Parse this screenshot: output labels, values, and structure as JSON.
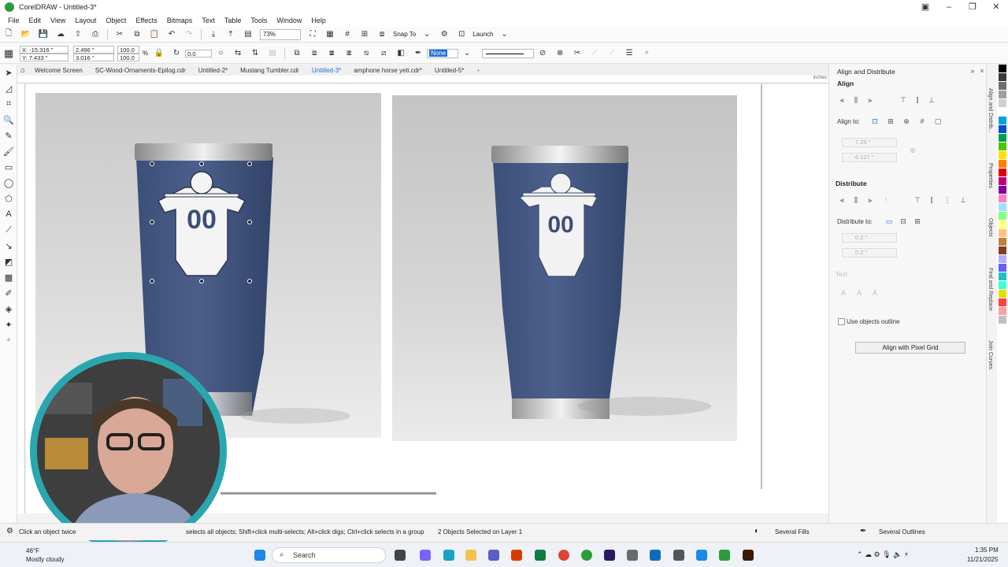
{
  "app": {
    "title": "CorelDRAW - Untitled-3*"
  },
  "menu": [
    "File",
    "Edit",
    "View",
    "Layout",
    "Object",
    "Effects",
    "Bitmaps",
    "Text",
    "Table",
    "Tools",
    "Window",
    "Help"
  ],
  "toolbar": {
    "zoom": "73%",
    "snap_to": "Snap To",
    "launch": "Launch"
  },
  "propbar": {
    "x": "X: -15.316 \"",
    "y": "Y: 7.433 \"",
    "w": "2.496 \"",
    "h": "3.016 \"",
    "sx": "100.0",
    "sy": "100.0",
    "pct": "%",
    "angle": "0.0",
    "outline": "None"
  },
  "tabs": [
    {
      "label": "Welcome Screen"
    },
    {
      "label": "SC-Wood-Ornaments-Epilog.cdr"
    },
    {
      "label": "Untitled-2*"
    },
    {
      "label": "Mustang Tumbler.cdr"
    },
    {
      "label": "Untitled-3*"
    },
    {
      "label": "amphone horse yeti.cdr*"
    },
    {
      "label": "Untitled-5*"
    }
  ],
  "ruler_unit": "inches",
  "panel": {
    "title": "Align and Distribute",
    "align_header": "Align",
    "align_to": "Align to:",
    "x_val": "7.25 \"",
    "y_val": "6.127 \"",
    "distribute_header": "Distribute",
    "distribute_to": "Distribute to:",
    "d1": "0.2 \"",
    "d2": "0.2 \"",
    "text_header": "Text",
    "use_outline": "Use objects outline",
    "pixel_grid_btn": "Align with Pixel Grid"
  },
  "dock_tabs": [
    "Align and Distrib...",
    "Properties",
    "Objects",
    "Find and Replace",
    "Join Curves"
  ],
  "palette": [
    "#000000",
    "#3a3a3a",
    "#6e6e6e",
    "#a0a0a0",
    "#d0d0d0",
    "#ffffff",
    "#00a0e0",
    "#0050c8",
    "#00a050",
    "#50c000",
    "#ffe000",
    "#ff8000",
    "#e00000",
    "#c00070",
    "#8000a0",
    "#ff80c0",
    "#a0e0ff",
    "#80ff80",
    "#ffff80",
    "#ffc080",
    "#c08040",
    "#804020",
    "#b0b0ff",
    "#6060ff",
    "#20c0c0",
    "#40ffd0",
    "#e0e000",
    "#ff4040",
    "#ffa0a0",
    "#c0c0c0"
  ],
  "status": {
    "hint": "Click an object twice",
    "hint2": "selects all objects; Shift+click multi-selects; Alt+click digs; Ctrl+click selects in a group",
    "selection": "2 Objects Selected on Layer 1",
    "fill": "Several Fills",
    "outline": "Several Outlines"
  },
  "taskbar": {
    "temp": "46°F",
    "weather": "Mostly cloudy",
    "search": "Search",
    "time": "1:35 PM",
    "date": "11/21/2025"
  },
  "artwork": {
    "number": "00"
  }
}
